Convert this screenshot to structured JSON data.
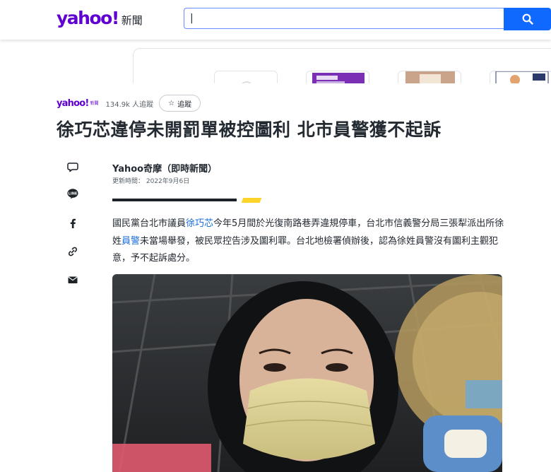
{
  "header": {
    "logo": "yahoo!",
    "logo_section": "新聞",
    "search_value": "|",
    "search_icon": "search-icon"
  },
  "provider": {
    "logo": "yahoo!",
    "logo_sub": "新聞",
    "followers": "134.9k 人追蹤",
    "follow_label": "追蹤"
  },
  "article": {
    "title": "徐巧芯違停未開罰單被控圖利 北市員警獲不起訴",
    "author": "Yahoo奇摩（即時新聞）",
    "updated": "更新時間： 2022年9月6日",
    "body": {
      "p1_a": "國民黨台北市議員",
      "p1_link1": "徐巧芯",
      "p1_b": "今年5月間於光復南路巷弄違規停車，台北市信義警分局三張犁派出所徐姓",
      "p1_link2": "員警",
      "p1_c": "未當場舉發，被民眾控告涉及圖利罪。台北地檢署偵辦後，認為徐姓員警沒有圖利主觀犯意，予不起訴處分。"
    }
  },
  "share_icons": [
    "comment-icon",
    "line-icon",
    "facebook-icon",
    "link-icon",
    "mail-icon"
  ],
  "colors": {
    "brand": "#6001d2",
    "search_button": "#0f69ff",
    "link": "#1a6ed8",
    "accent_yellow": "#ffd42a"
  }
}
